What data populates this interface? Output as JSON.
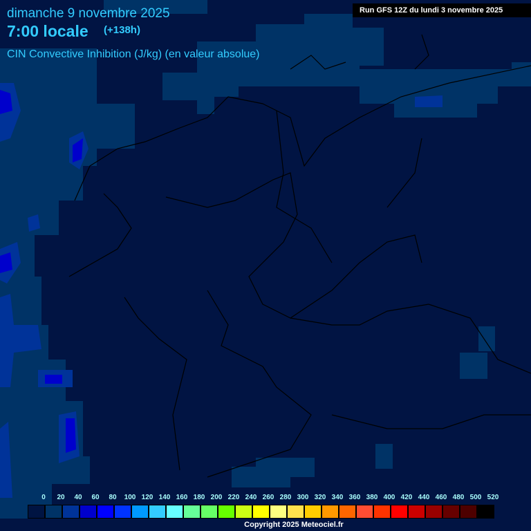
{
  "header": {
    "date": "dimanche 9 novembre 2025",
    "time": "7:00 locale",
    "offset": "(+138h)",
    "parameter": "CIN Convective Inhibition (J/kg) (en valeur absolue)",
    "run": "Run GFS 12Z du lundi 3 novembre 2025"
  },
  "legend": {
    "labels": [
      "0",
      "20",
      "40",
      "60",
      "80",
      "100",
      "120",
      "140",
      "160",
      "180",
      "200",
      "220",
      "240",
      "260",
      "280",
      "300",
      "320",
      "340",
      "360",
      "380",
      "400",
      "420",
      "440",
      "460",
      "480",
      "500",
      "520"
    ],
    "colors": [
      "#001442",
      "#003366",
      "#003399",
      "#0000cc",
      "#0000ff",
      "#0033ff",
      "#0099ff",
      "#33ccff",
      "#66ffff",
      "#66ff99",
      "#66ff66",
      "#66ff00",
      "#ccff14",
      "#ffff00",
      "#ffff80",
      "#ffe14d",
      "#ffcc00",
      "#ff9900",
      "#ff6600",
      "#ff4d33",
      "#ff3300",
      "#ff0000",
      "#cc0000",
      "#990000",
      "#660000",
      "#4d0000",
      "#000000"
    ]
  },
  "copyright": "Copyright 2025 Meteociel.fr",
  "colors": {
    "background": "#011443",
    "low_cin": "#003366",
    "mid_cin": "#003399",
    "high_cin": "#0000cc"
  }
}
